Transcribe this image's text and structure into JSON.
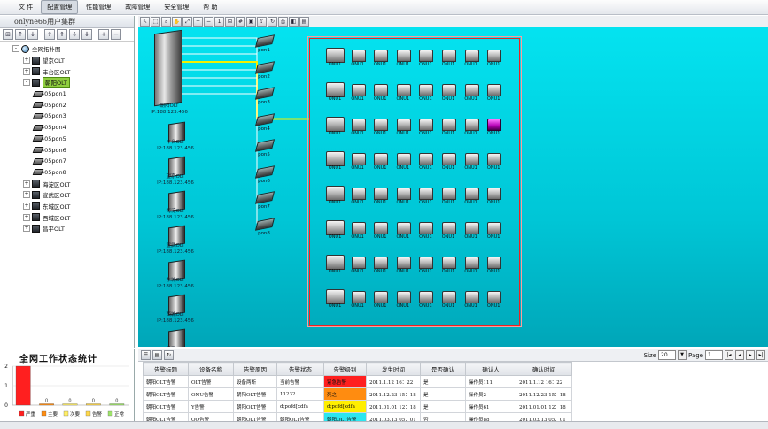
{
  "menu": [
    "文 件",
    "配置管理",
    "性能管理",
    "故障管理",
    "安全管理",
    "帮 助"
  ],
  "menu_active": 1,
  "left_panel": {
    "title": "onlyne66用户集群",
    "toolbar_icons": [
      "view-icon",
      "sort-asc-icon",
      "sort-desc-icon",
      "up-icon",
      "up-all-icon",
      "down-icon",
      "down-all-icon",
      "expand-icon",
      "collapse-icon"
    ],
    "tree": [
      {
        "label": "全网拓扑图",
        "level": 0,
        "icon": "globe-icon",
        "expander": "-"
      },
      {
        "label": "望京OLT",
        "level": 1,
        "icon": "olt-icon",
        "expander": "+"
      },
      {
        "label": "丰台区OLT",
        "level": 1,
        "icon": "olt-icon",
        "expander": "+"
      },
      {
        "label": "朝阳OLT",
        "level": 1,
        "icon": "olt-icon",
        "expander": "-",
        "selected": true
      },
      {
        "label": "405pon1",
        "level": 2,
        "icon": "pon-icon"
      },
      {
        "label": "405pon2",
        "level": 2,
        "icon": "pon-icon"
      },
      {
        "label": "405pon3",
        "level": 2,
        "icon": "pon-icon"
      },
      {
        "label": "405pon4",
        "level": 2,
        "icon": "pon-icon"
      },
      {
        "label": "405pon5",
        "level": 2,
        "icon": "pon-icon"
      },
      {
        "label": "405pon6",
        "level": 2,
        "icon": "pon-icon"
      },
      {
        "label": "405pon7",
        "level": 2,
        "icon": "pon-icon"
      },
      {
        "label": "405pon8",
        "level": 2,
        "icon": "pon-icon"
      },
      {
        "label": "海淀区OLT",
        "level": 1,
        "icon": "olt-icon",
        "expander": "+"
      },
      {
        "label": "宣武区OLT",
        "level": 1,
        "icon": "olt-icon",
        "expander": "+"
      },
      {
        "label": "东城区OLT",
        "level": 1,
        "icon": "olt-icon",
        "expander": "+"
      },
      {
        "label": "西城区OLT",
        "level": 1,
        "icon": "olt-icon",
        "expander": "+"
      },
      {
        "label": "昌平OLT",
        "level": 1,
        "icon": "olt-icon",
        "expander": "+"
      }
    ]
  },
  "stats": {
    "title": "全网工作状态统计",
    "chart_data": {
      "type": "bar",
      "categories": [
        "严重",
        "主要",
        "次要",
        "告警",
        "正常"
      ],
      "values": [
        2,
        0,
        0,
        0,
        0
      ],
      "value_labels": [
        "2",
        "0",
        "0",
        "0",
        "0"
      ],
      "ylim": [
        0,
        2
      ],
      "yticks": [
        "0",
        "1",
        "2"
      ],
      "colors": [
        "#ff1f1f",
        "#ff8c10",
        "#ffee66",
        "#ffd84a",
        "#9ee36a"
      ]
    }
  },
  "topology": {
    "main_olt": {
      "name": "朝阳OLT",
      "ip": "IP:188.123.456"
    },
    "olts": [
      {
        "name": "丰台OLT",
        "ip": "IP:188.123.456"
      },
      {
        "name": "望京OLT",
        "ip": "IP:188.123.456"
      },
      {
        "name": "海淀OLT",
        "ip": "IP:188.123.456"
      },
      {
        "name": "宣武OLT",
        "ip": "IP:188.123.456"
      },
      {
        "name": "东城OLT",
        "ip": "IP:188.123.456"
      },
      {
        "name": "西城OLT",
        "ip": "IP:188.123.456"
      },
      {
        "name": "昌平OLT",
        "ip": "IP:188.123.456"
      }
    ],
    "pons": [
      "pon1",
      "pon2",
      "pon3",
      "pon4",
      "pon5",
      "pon6",
      "pon7",
      "pon8"
    ],
    "selected_pon": 4,
    "onu_label": "ONU1",
    "onu_rows": 8,
    "onu_cols": 8,
    "alert_onu": {
      "row": 2,
      "col": 7
    },
    "colors": {
      "link": "#ffffff",
      "selected_link": "#f3f000",
      "frame": "#ee2222"
    }
  },
  "canvas_toolbar_icons": [
    "pointer-icon",
    "select-icon",
    "zoom-icon",
    "hand-icon",
    "fit-icon",
    "zoom-in-icon",
    "zoom-out-icon",
    "zoom-reset-icon",
    "layout-icon",
    "grid-icon",
    "overview-icon",
    "export-icon",
    "refresh-icon",
    "print-icon",
    "preview-icon",
    "save-icon"
  ],
  "alarm": {
    "toolbar_icons": [
      "list-icon",
      "export-icon",
      "refresh-icon"
    ],
    "pager": {
      "size_label": "Size",
      "size": "20",
      "page_label": "Page",
      "page": "1",
      "total": "1"
    },
    "columns": [
      "告警标题",
      "设备名称",
      "告警原因",
      "告警状态",
      "告警级别",
      "发生时间",
      "是否确认",
      "确认人",
      "确认时间"
    ],
    "rows": [
      {
        "cells": [
          "朝阳OLT告警",
          "OLT告警",
          "设备两断",
          "当前告警",
          "紧急告警",
          "2011.1.12 16：22",
          "是",
          "操作员111",
          "2011.1.12 16：22"
        ],
        "severity": "red"
      },
      {
        "cells": [
          "朝阳OLT告警",
          "ONU告警",
          "朝阳OLT告警",
          "11232",
          "死之",
          "2011.12.23 15：18",
          "是",
          "操作员2",
          "2011.12.23 15：18"
        ],
        "severity": "orange"
      },
      {
        "cells": [
          "朝阳OLT告警",
          "Y告警",
          "朝阳OLT告警",
          "d;pofd[xdfa",
          "d;pofd[xdfa",
          "2011.01.01 12：18",
          "是",
          "操作员61",
          "2011.01.01 12：18"
        ],
        "severity": "yellow"
      },
      {
        "cells": [
          "朝阳OLT告警",
          "OO告警",
          "朝阳OLT告警",
          "朝阳OLT告警",
          "朝阳OLT告警",
          "2011.03.13 05：01",
          "否",
          "操作员88",
          "2011.03.13 05：01"
        ],
        "severity": "cyan"
      }
    ]
  }
}
